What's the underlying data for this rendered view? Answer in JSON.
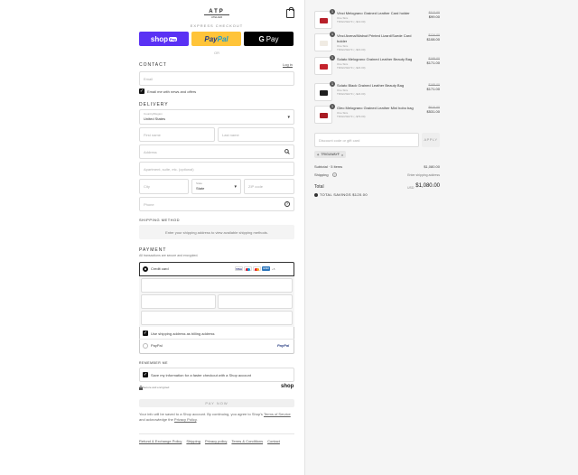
{
  "brand": {
    "name": "ATP",
    "sub": "ATELIER"
  },
  "express": {
    "label": "EXPRESS CHECKOUT",
    "shoppay": "shop",
    "shoppay_badge": "Pay",
    "paypal_a": "Pay",
    "paypal_b": "Pal",
    "gpay": "Pay",
    "or": "OR"
  },
  "contact": {
    "title": "CONTACT",
    "login": "Log in",
    "email_placeholder": "Email",
    "news_label": "Email me with news and offers"
  },
  "delivery": {
    "title": "DELIVERY",
    "country_label": "Country/Region",
    "country_value": "United States",
    "first_name": "First name",
    "last_name": "Last name",
    "address": "Address",
    "apt": "Apartment, suite, etc. (optional)",
    "city": "City",
    "state_label": "State",
    "state_value": "State",
    "zip": "ZIP code",
    "phone": "Phone"
  },
  "shipping": {
    "title": "SHIPPING METHOD",
    "notice": "Enter your shipping address to view available shipping methods."
  },
  "payment": {
    "title": "PAYMENT",
    "subtitle": "All transactions are secure and encrypted.",
    "credit_card": "Credit card",
    "more": "+5",
    "billing_same": "Use shipping address as billing address",
    "paypal": "PayPal",
    "paypal_logo": "PayPal"
  },
  "remember": {
    "title": "REMEMBER ME",
    "label": "Save my information for a faster checkout with a Shop account",
    "secure": "Secure and encrypted",
    "shop_logo": "shop"
  },
  "pay_now": "PAY NOW",
  "legal": {
    "text_a": "Your info will be saved to a Shop account. By continuing, you agree to Shop's ",
    "terms": "Terms of Service",
    "text_b": " and acknowledge the ",
    "privacy": "Privacy Policy",
    "text_c": "."
  },
  "footer": [
    "Refund & Exchange Policy",
    "Shipping",
    "Privacy policy",
    "Terms & Conditions",
    "Contact"
  ],
  "items": [
    {
      "qty": "1",
      "name": "Vinci Melograno Grained Leather Card holder",
      "size": "One Size",
      "code": "TRIGUWAYF ( -$13.00)",
      "was": "$112.00",
      "now": "$99.00",
      "color": "#b8202a"
    },
    {
      "qty": "1",
      "name": "Vinci Avena/Walnut Printed Lizard/Suede Card holder",
      "size": "One Size",
      "code": "TRIGUWAYF ( -$16.00)",
      "was": "$124.00",
      "now": "$108.00",
      "color": "#f0ebe3"
    },
    {
      "qty": "1",
      "name": "Solato Melograno Grained Leather Beauty Bag",
      "size": "One Size",
      "code": "TRIGUWAYF ( -$24.00)",
      "was": "$195.00",
      "now": "$171.00",
      "color": "#c4232c"
    },
    {
      "qty": "1",
      "name": "Solato Black Grained Leather Beauty Bag",
      "size": "One Size",
      "code": "TRIGUWAYF ( -$24.00)",
      "was": "$195.00",
      "now": "$171.00",
      "color": "#1e1e1e"
    },
    {
      "qty": "1",
      "name": "Gleo Melograno Grained Leather Mini hobo bag",
      "size": "One Size",
      "code": "TRIGUWAYF ( -$79.00)",
      "was": "$610.00",
      "now": "$531.00",
      "color": "#a81c24"
    }
  ],
  "discount": {
    "placeholder": "Discount code or gift card",
    "apply": "APPLY",
    "tag": "TRIGUWAYF"
  },
  "summary": {
    "subtotal_label": "Subtotal · 5 items",
    "subtotal": "$1,080.00",
    "shipping_label": "Shipping",
    "shipping_value": "Enter shipping address",
    "total_label": "Total",
    "currency": "USD",
    "total": "$1,080.00",
    "savings": "TOTAL SAVINGS $120.00"
  }
}
